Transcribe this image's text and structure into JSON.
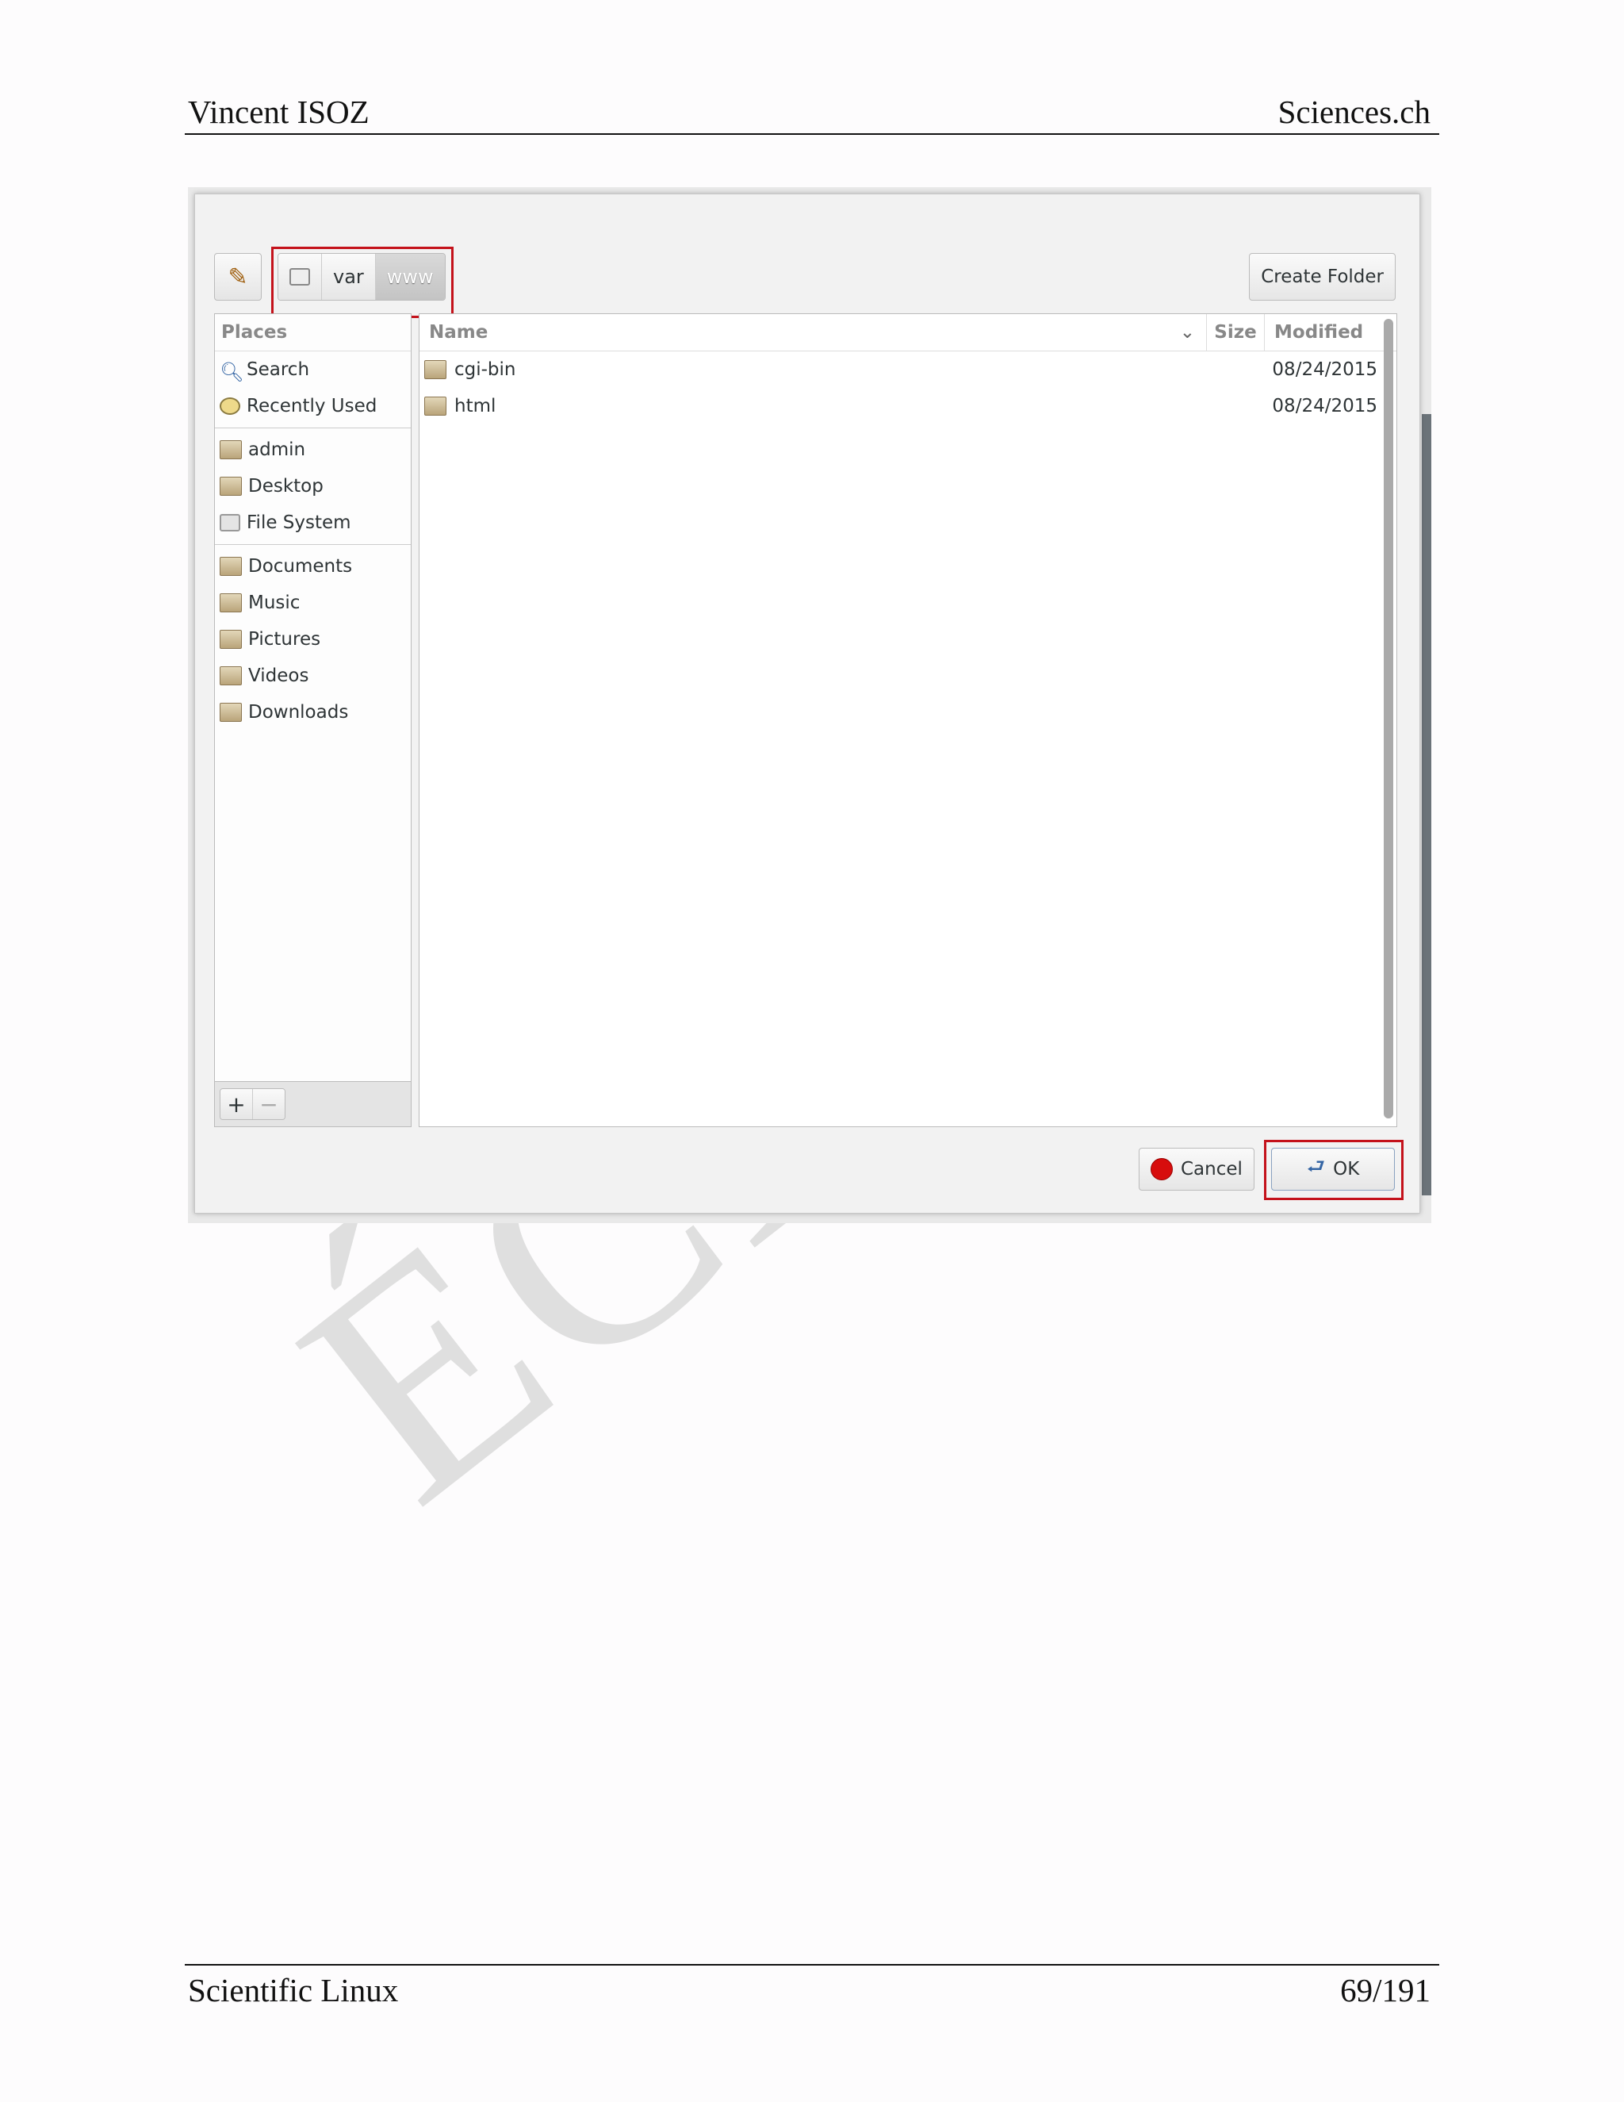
{
  "header": {
    "author": "Vincent ISOZ",
    "site": "Sciences.ch"
  },
  "footer": {
    "title": "Scientific Linux",
    "page": "69/191"
  },
  "watermark": "ÉCHA",
  "dialog": {
    "path": [
      "var",
      "www"
    ],
    "create_folder_label": "Create Folder",
    "places_header": "Places",
    "places": [
      {
        "label": "Search",
        "icon": "search-icon"
      },
      {
        "label": "Recently Used",
        "icon": "clock-icon"
      },
      {
        "label": "admin",
        "icon": "home-folder-icon"
      },
      {
        "label": "Desktop",
        "icon": "desktop-folder-icon"
      },
      {
        "label": "File System",
        "icon": "disk-icon"
      },
      {
        "label": "Documents",
        "icon": "documents-folder-icon"
      },
      {
        "label": "Music",
        "icon": "music-folder-icon"
      },
      {
        "label": "Pictures",
        "icon": "pictures-folder-icon"
      },
      {
        "label": "Videos",
        "icon": "videos-folder-icon"
      },
      {
        "label": "Downloads",
        "icon": "downloads-folder-icon"
      }
    ],
    "columns": {
      "name": "Name",
      "size": "Size",
      "modified": "Modified"
    },
    "files": [
      {
        "name": "cgi-bin",
        "size": "",
        "modified": "08/24/2015"
      },
      {
        "name": "html",
        "size": "",
        "modified": "08/24/2015"
      }
    ],
    "add_label": "+",
    "remove_label": "−",
    "cancel_label": "Cancel",
    "ok_label": "OK",
    "highlight_color": "#c4121b"
  }
}
